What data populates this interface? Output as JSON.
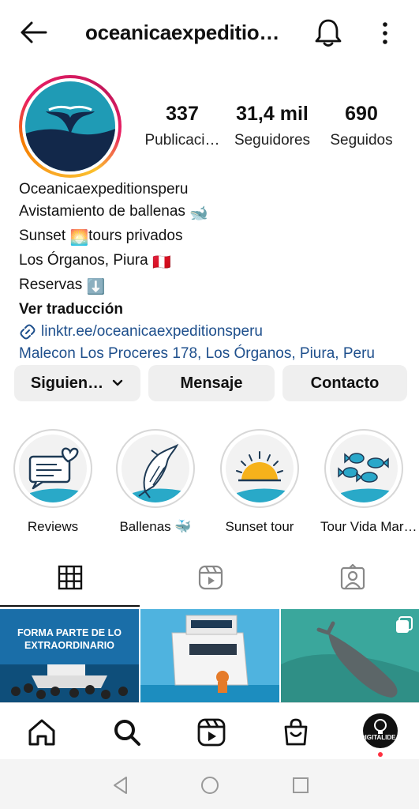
{
  "header": {
    "title": "oceanicaexpeditio…",
    "back_icon": "arrow-left-icon",
    "bell_icon": "bell-icon",
    "more_icon": "more-vertical-icon"
  },
  "profile": {
    "stats": [
      {
        "value": "337",
        "label": "Publicaci…"
      },
      {
        "value": "31,4 mil",
        "label": "Seguidores"
      },
      {
        "value": "690",
        "label": "Seguidos"
      }
    ],
    "name": "Oceanicaexpeditionsperu",
    "bio": {
      "line1": "Avistamiento de ballenas",
      "line1_emoji": "🐋",
      "line2_a": "Sunset",
      "line2_emoji": "🌅",
      "line2_b": "tours privados",
      "line3": "Los Órganos, Piura",
      "line3_emoji": "🇵🇪",
      "line4": "Reservas",
      "line4_emoji": "⬇️"
    },
    "translate_label": "Ver traducción",
    "link": "linktr.ee/oceanicaexpeditionsperu",
    "address": "Malecon Los Proceres 178, Los Órganos, Piura, Peru"
  },
  "actions": {
    "following": "Siguien…",
    "message": "Mensaje",
    "contact": "Contacto"
  },
  "highlights": [
    {
      "label": "Reviews",
      "icon": "review-speech-icon"
    },
    {
      "label": "Ballenas 🐳",
      "icon": "whale-icon"
    },
    {
      "label": "Sunset tour",
      "icon": "sunset-icon"
    },
    {
      "label": "Tour Vida Mar…",
      "icon": "fish-icon"
    }
  ],
  "tabs": [
    {
      "name": "grid",
      "icon": "grid-icon"
    },
    {
      "name": "reels",
      "icon": "reels-icon"
    },
    {
      "name": "tagged",
      "icon": "tagged-icon"
    }
  ],
  "posts": [
    {
      "caption_line1": "FORMA PARTE DE LO",
      "caption_line2": "EXTRAORDINARIO"
    },
    {
      "caption_line1": "",
      "caption_line2": ""
    },
    {
      "caption_line1": "",
      "caption_line2": ""
    }
  ],
  "bottom_nav": {
    "items": [
      "home-icon",
      "search-icon",
      "reels-icon",
      "shop-icon",
      "profile-avatar"
    ],
    "avatar_text": "DIGITALIDEA"
  },
  "colors": {
    "link": "#1e4f8c",
    "ocean": "#1f9bb5",
    "navy": "#12284a",
    "notification": "#ff3040"
  }
}
